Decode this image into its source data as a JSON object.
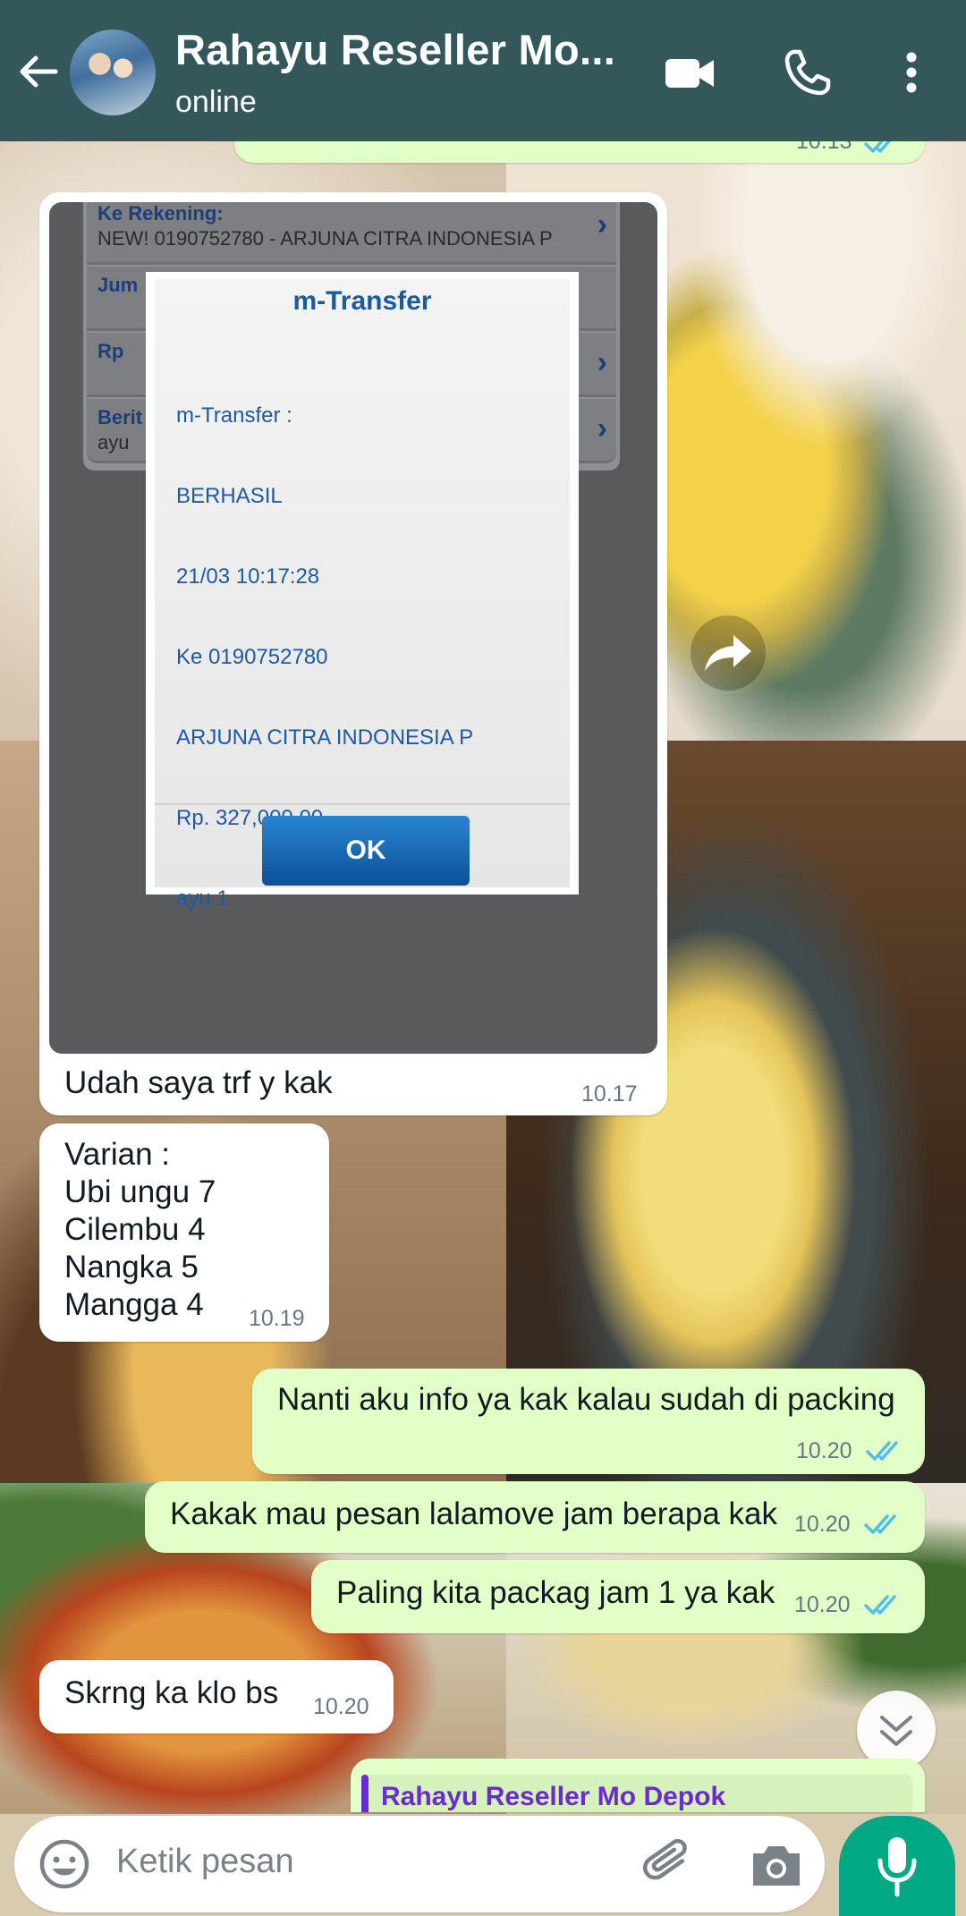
{
  "header": {
    "back_icon": "arrow-left-icon",
    "contact_name": "Rahayu Reseller Mo...",
    "status": "online",
    "actions": [
      "video-call-icon",
      "voice-call-icon",
      "more-vert-icon"
    ],
    "color": "#34585a"
  },
  "messages": [
    {
      "direction": "incoming",
      "type": "image",
      "image_content": {
        "form_rows": [
          {
            "label": "Ke Rekening:",
            "value": "NEW! 0190752780 - ARJUNA CITRA INDONESIA P"
          },
          {
            "label": "Jum",
            "value": ""
          },
          {
            "label": "Rp",
            "value": ""
          },
          {
            "label": "Berit",
            "value": "ayu"
          }
        ],
        "dialog_title": "m-Transfer",
        "dialog_lines": [
          "m-Transfer :",
          "BERHASIL",
          "21/03 10:17:28",
          "Ke 0190752780",
          "ARJUNA CITRA INDONESIA P",
          "Rp. 327,000.00",
          "ayu 1"
        ],
        "ok_label": "OK"
      },
      "caption": "Udah saya trf y kak",
      "time": "10.17"
    },
    {
      "direction": "incoming",
      "type": "text",
      "text": "Varian :\nUbi ungu 7\nCilembu 4\nNangka 5\nMangga 4",
      "time": "10.19"
    },
    {
      "direction": "outgoing",
      "type": "text",
      "text": "Nanti aku info ya kak kalau sudah di packing",
      "time": "10.20",
      "status": "read"
    },
    {
      "direction": "outgoing",
      "type": "text",
      "text": "Kakak mau pesan lalamove jam berapa kak",
      "time": "10.20",
      "status": "read"
    },
    {
      "direction": "outgoing",
      "type": "text",
      "text": "Paling kita packag jam 1 ya kak",
      "time": "10.20",
      "status": "read"
    },
    {
      "direction": "incoming",
      "type": "text",
      "text": "Skrng ka klo bs",
      "time": "10.20"
    }
  ],
  "partial_top_time": "10.13",
  "quoted_preview_name": "Rahayu Reseller Mo Depok",
  "composer": {
    "placeholder": "Ketik pesan",
    "icons": [
      "emoji-icon",
      "attach-icon",
      "camera-icon",
      "mic-icon"
    ]
  },
  "colors": {
    "incoming_bubble": "#ffffff",
    "outgoing_bubble": "#e2ffc7",
    "read_ticks": "#53bdeb",
    "mic_button": "#00a884"
  }
}
